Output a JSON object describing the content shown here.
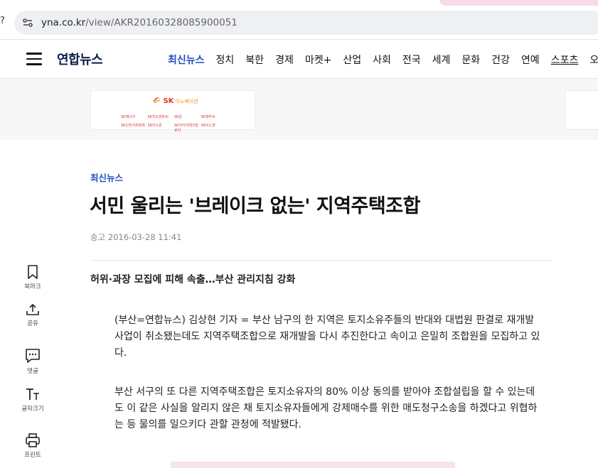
{
  "browser": {
    "left_glyph": "?",
    "url_host": "yna.co.kr",
    "url_path": "/view/AKR20160328085900051"
  },
  "header": {
    "logo": "연합뉴스",
    "nav": [
      {
        "label": "최신뉴스",
        "active": true
      },
      {
        "label": "정치"
      },
      {
        "label": "북한"
      },
      {
        "label": "경제"
      },
      {
        "label": "마켓+"
      },
      {
        "label": "산업"
      },
      {
        "label": "사회"
      },
      {
        "label": "전국"
      },
      {
        "label": "세계"
      },
      {
        "label": "문화"
      },
      {
        "label": "건강"
      },
      {
        "label": "연예"
      },
      {
        "label": "스포츠"
      },
      {
        "label": "오피니"
      }
    ]
  },
  "ad": {
    "brand": "SK",
    "brand_sub": "이노베이션",
    "links": [
      "SK에너지",
      "SK지오센트릭",
      "SK온",
      "SK엔무브",
      "SK인천석유화학",
      "SK어스온",
      "SK아이이테크놀로지",
      "SK이노엔"
    ]
  },
  "article": {
    "section": "최신뉴스",
    "headline": "서민 울리는 '브레이크 없는' 지역주택조합",
    "dateline": "송고 2016-03-28 11:41",
    "subtitle": "허위·과장 모집에 피해 속출…부산 관리지침 강화",
    "paragraphs": [
      "(부산=연합뉴스) 김상현 기자 = 부산 남구의 한 지역은 토지소유주들의 반대와 대법원 판결로 재개발사업이 취소됐는데도 지역주택조합으로 재개발을 다시 추진한다고 속이고 은밀히 조합원을 모집하고 있다.",
      "부산 서구의 또 다른 지역주택조합은 토지소유자의 80% 이상 동의를 받아야 조합설립을 할 수 있는데도 이 같은 사실을 알리지 않은 채 토지소유자들에게 강제매수를 위한 매도청구소송을 하겠다고 위협하는 등 물의를 일으키다 관할 관청에 적발됐다."
    ]
  },
  "tools": {
    "bookmark": "북마크",
    "share": "공유",
    "comment": "댓글",
    "fontsize": "글자크기",
    "print": "프린트"
  },
  "colors": {
    "accent": "#1f4dbf",
    "logo": "#0b1d4a"
  }
}
